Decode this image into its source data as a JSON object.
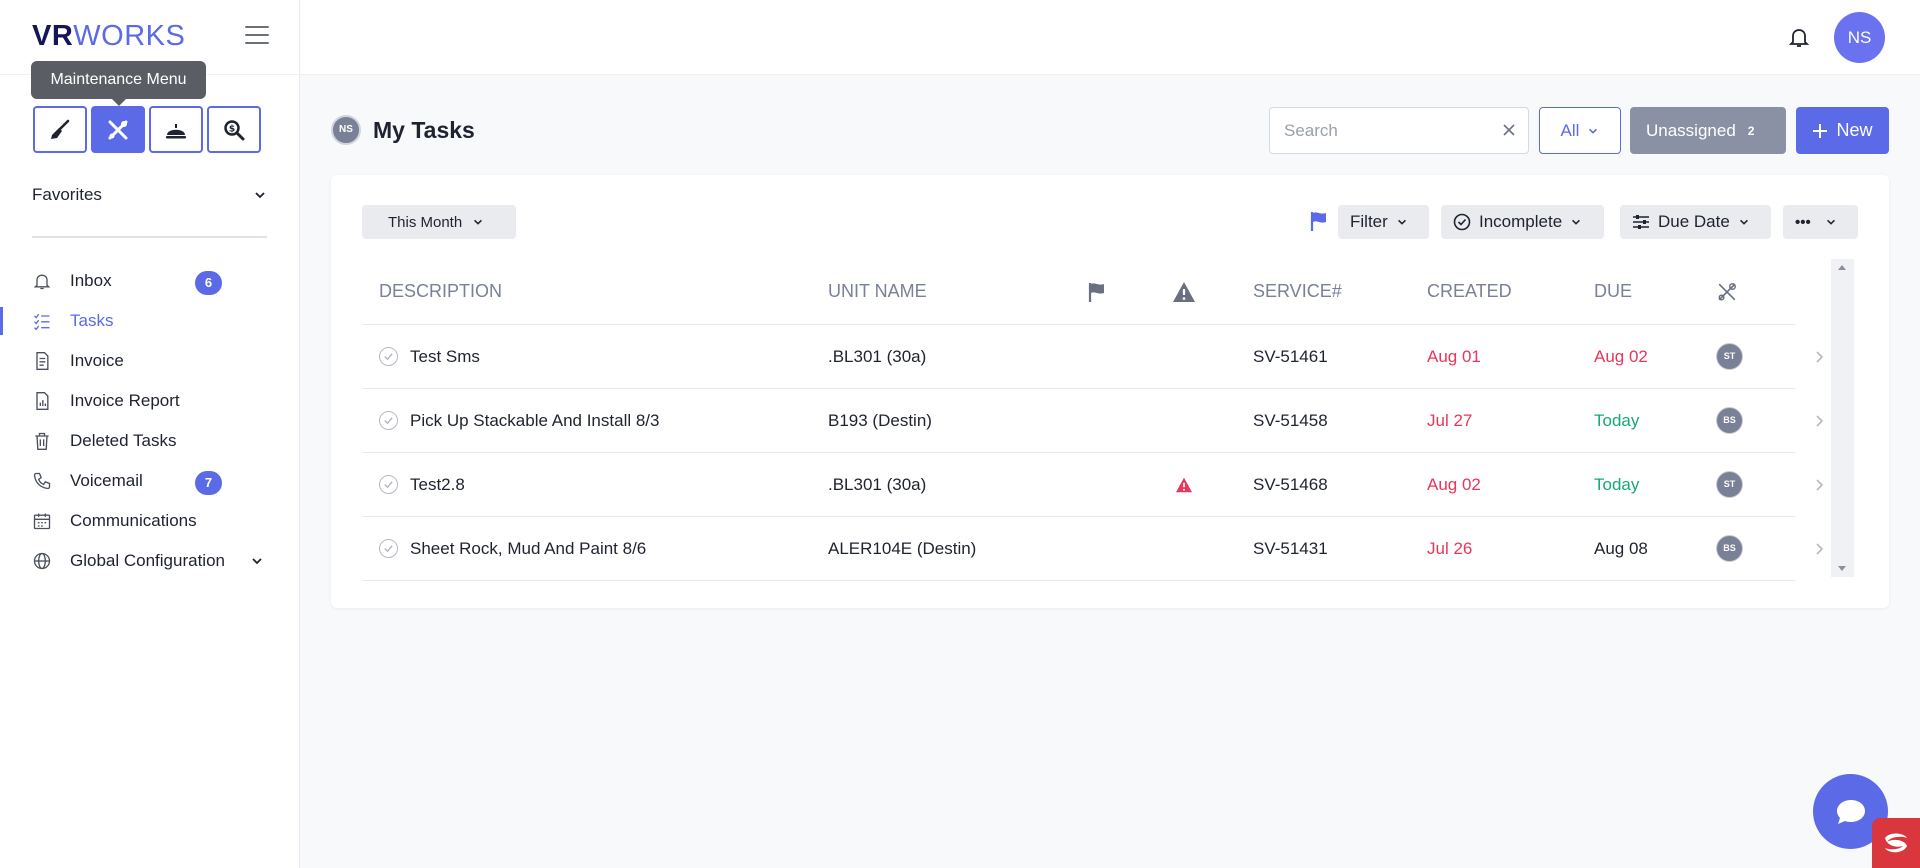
{
  "app": {
    "logo_vr": "VR",
    "logo_works": "WORKS",
    "tooltip": "Maintenance Menu"
  },
  "menu_icons": [
    {
      "name": "housekeeping-icon",
      "active": false
    },
    {
      "name": "maintenance-tools-icon",
      "active": true
    },
    {
      "name": "concierge-bell-icon",
      "active": false
    },
    {
      "name": "inspection-search-icon",
      "active": false
    }
  ],
  "sidebar": {
    "favorites_label": "Favorites",
    "items": [
      {
        "label": "Inbox",
        "icon": "bell-icon",
        "badge": "6"
      },
      {
        "label": "Tasks",
        "icon": "task-list-icon",
        "active": true
      },
      {
        "label": "Invoice",
        "icon": "document-icon"
      },
      {
        "label": "Invoice Report",
        "icon": "report-icon"
      },
      {
        "label": "Deleted Tasks",
        "icon": "trash-icon"
      },
      {
        "label": "Voicemail",
        "icon": "phone-icon",
        "badge": "7"
      },
      {
        "label": "Communications",
        "icon": "calendar-icon"
      },
      {
        "label": "Global Configuration",
        "icon": "globe-icon"
      }
    ]
  },
  "topbar": {
    "user_initials": "NS"
  },
  "header": {
    "avatar_initials": "NS",
    "title": "My Tasks",
    "search_placeholder": "Search",
    "all_label": "All",
    "unassigned_label": "Unassigned",
    "unassigned_count": "2",
    "new_label": "New"
  },
  "toolbar": {
    "period_label": "This Month",
    "filter_label": "Filter",
    "status_label": "Incomplete",
    "sort_label": "Due Date",
    "more_label": "•••"
  },
  "table": {
    "headers": {
      "description": "DESCRIPTION",
      "unit": "UNIT NAME",
      "service": "SERVICE#",
      "created": "CREATED",
      "due": "DUE"
    },
    "rows": [
      {
        "description": "Test Sms",
        "unit": ".BL301 (30a)",
        "warning": false,
        "service": "SV-51461",
        "created": "Aug 01",
        "due": "Aug 02",
        "due_status": "overdue",
        "assignee": "ST"
      },
      {
        "description": "Pick Up Stackable And Install 8/3",
        "unit": "B193 (Destin)",
        "warning": false,
        "service": "SV-51458",
        "created": "Jul 27",
        "due": "Today",
        "due_status": "today",
        "assignee": "BS"
      },
      {
        "description": "Test2.8",
        "unit": ".BL301 (30a)",
        "warning": true,
        "service": "SV-51468",
        "created": "Aug 02",
        "due": "Today",
        "due_status": "today",
        "assignee": "ST"
      },
      {
        "description": "Sheet Rock, Mud And Paint 8/6",
        "unit": "ALER104E (Destin)",
        "warning": false,
        "service": "SV-51431",
        "created": "Jul 26",
        "due": "Aug 08",
        "due_status": "normal",
        "assignee": "BS"
      }
    ]
  },
  "colors": {
    "accent": "#5b6ae6",
    "overdue": "#e8365c",
    "today": "#17a67a"
  }
}
